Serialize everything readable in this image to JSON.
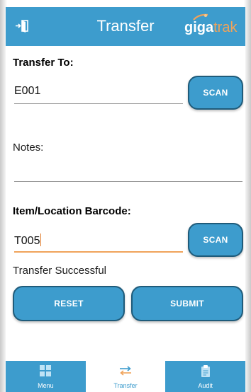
{
  "header": {
    "title": "Transfer",
    "logo": "gigatrak",
    "back_icon": "exit-door-icon"
  },
  "form": {
    "transfer_to": {
      "label": "Transfer To:",
      "value": "E001",
      "scan_label": "SCAN"
    },
    "notes": {
      "label": "Notes:",
      "value": ""
    },
    "barcode": {
      "label": "Item/Location Barcode:",
      "value": "T005",
      "scan_label": "SCAN"
    },
    "status": "Transfer Successful",
    "reset_label": "RESET",
    "submit_label": "SUBMIT"
  },
  "nav": {
    "items": [
      {
        "label": "Menu",
        "icon": "grid-icon",
        "active": false
      },
      {
        "label": "Transfer",
        "icon": "transfer-arrows-icon",
        "active": true
      },
      {
        "label": "Audit",
        "icon": "clipboard-icon",
        "active": false
      }
    ]
  },
  "colors": {
    "primary": "#3d9ccd",
    "accent": "#f0a35a",
    "button_border": "#1f5b7a"
  }
}
